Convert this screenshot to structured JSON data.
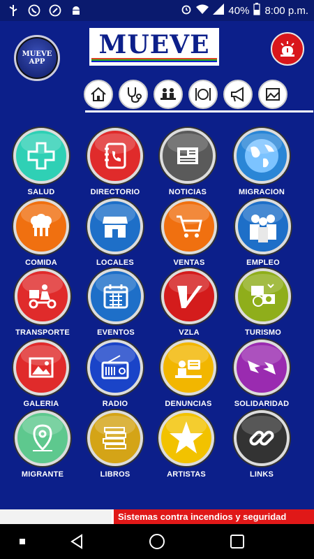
{
  "status_bar": {
    "battery": "40%",
    "time": "8:00 p.m.",
    "icons": [
      "usb-icon",
      "whatsapp-icon",
      "phone-circle-icon",
      "android-icon",
      "alarm-icon",
      "wifi-icon",
      "signal-icon",
      "battery-icon"
    ]
  },
  "header": {
    "logo_line1": "MUEVE",
    "logo_line2": "APP",
    "brand": "MUEVE",
    "categories": [
      "home-icon",
      "stethoscope-icon",
      "meeting-icon",
      "restaurant-icon",
      "megaphone-icon",
      "gallery-icon"
    ]
  },
  "colors": {
    "background": "#0c1f8a",
    "salud": "#2fd0b5",
    "directorio": "#e02b2b",
    "noticias": "#5a5a5a",
    "migracion": "#2a86d6",
    "comida": "#f07010",
    "locales": "#1e6fc8",
    "ventas": "#f07010",
    "empleo": "#1e6fc8",
    "transporte": "#e02b2b",
    "eventos": "#1e6fc8",
    "vzla": "#d41c1c",
    "turismo": "#8fae1b",
    "galeria": "#e02b2b",
    "radio": "#1a44c8",
    "denuncias": "#f2b600",
    "solidaridad": "#9a2bb0",
    "migrante": "#5ec88e",
    "libros": "#d4a417",
    "artistas": "#f2c200",
    "links": "#333333"
  },
  "tiles": [
    {
      "label": "SALUD",
      "icon": "medical-cross-icon"
    },
    {
      "label": "DIRECTORIO",
      "icon": "phonebook-icon"
    },
    {
      "label": "NOTICIAS",
      "icon": "newspaper-icon"
    },
    {
      "label": "MIGRACION",
      "icon": "globe-icon"
    },
    {
      "label": "COMIDA",
      "icon": "chef-hats-icon"
    },
    {
      "label": "LOCALES",
      "icon": "storefront-icon"
    },
    {
      "label": "VENTAS",
      "icon": "shopping-cart-icon"
    },
    {
      "label": "EMPLEO",
      "icon": "workers-icon"
    },
    {
      "label": "TRANSPORTE",
      "icon": "delivery-scooter-icon"
    },
    {
      "label": "EVENTOS",
      "icon": "calendar-icon"
    },
    {
      "label": "VZLA",
      "icon": "v-logo-icon"
    },
    {
      "label": "TURISMO",
      "icon": "tourism-photos-icon"
    },
    {
      "label": "GALERIA",
      "icon": "picture-icon"
    },
    {
      "label": "RADIO",
      "icon": "radio-icon"
    },
    {
      "label": "DENUNCIAS",
      "icon": "complaint-desk-icon"
    },
    {
      "label": "SOLIDARIDAD",
      "icon": "helping-hands-icon"
    },
    {
      "label": "MIGRANTE",
      "icon": "location-pin-icon"
    },
    {
      "label": "LIBROS",
      "icon": "books-icon"
    },
    {
      "label": "ARTISTAS",
      "icon": "star-icon"
    },
    {
      "label": "LINKS",
      "icon": "chain-link-icon"
    }
  ],
  "ad": {
    "text": "Sistemas contra incendios y seguridad"
  },
  "nav": [
    "recents-button",
    "back-button",
    "home-button",
    "overview-button"
  ]
}
